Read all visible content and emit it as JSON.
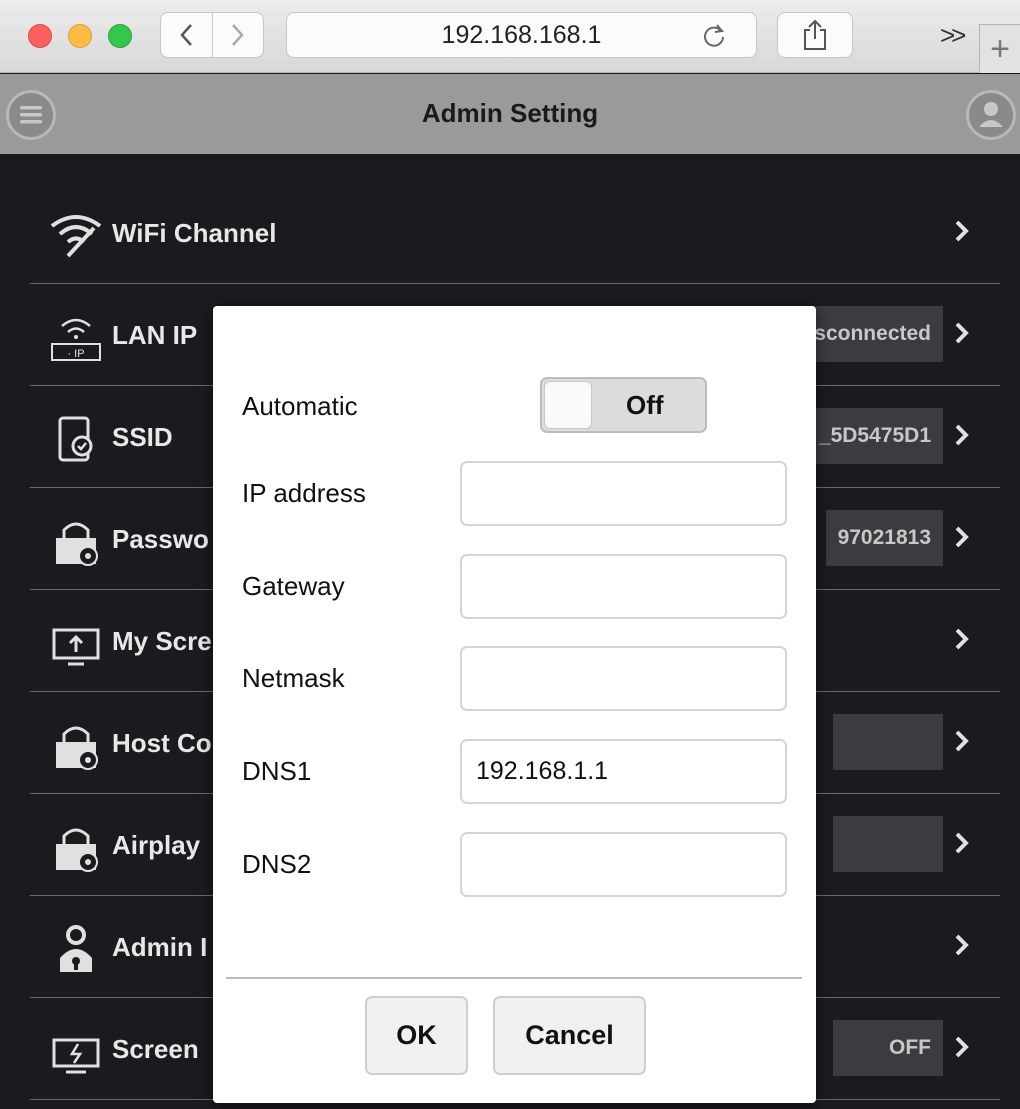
{
  "browser": {
    "url": "192.168.168.1",
    "overflow_label": ">>",
    "new_tab_label": "+"
  },
  "header": {
    "title": "Admin Setting"
  },
  "settings": [
    {
      "label": "WiFi Channel",
      "value": "",
      "icon": "wifi-icon"
    },
    {
      "label": "LAN IP",
      "value": "sconnected",
      "icon": "lan-ip-icon"
    },
    {
      "label": "SSID",
      "value": "_5D5475D1",
      "icon": "device-icon"
    },
    {
      "label": "Passwo",
      "value": "97021813",
      "icon": "lock-icon"
    },
    {
      "label": "My Scre",
      "value": "",
      "icon": "screen-upload-icon"
    },
    {
      "label": "Host Co",
      "value": "",
      "icon": "lock-icon"
    },
    {
      "label": "Airplay",
      "value": "",
      "icon": "lock-icon"
    },
    {
      "label": "Admin I",
      "value": "",
      "icon": "admin-user-icon"
    },
    {
      "label": "Screen",
      "value": "OFF",
      "icon": "screen-power-icon"
    }
  ],
  "dialog": {
    "automatic_label": "Automatic",
    "automatic_state": "Off",
    "ip_label": "IP address",
    "ip_value": "",
    "gateway_label": "Gateway",
    "gateway_value": "",
    "netmask_label": "Netmask",
    "netmask_value": "",
    "dns1_label": "DNS1",
    "dns1_value": "192.168.1.1",
    "dns2_label": "DNS2",
    "dns2_value": "",
    "ok_label": "OK",
    "cancel_label": "Cancel"
  },
  "colors": {
    "background": "#1a1a1f",
    "header": "#9a9a9a",
    "value_box": "#3c3c40"
  }
}
